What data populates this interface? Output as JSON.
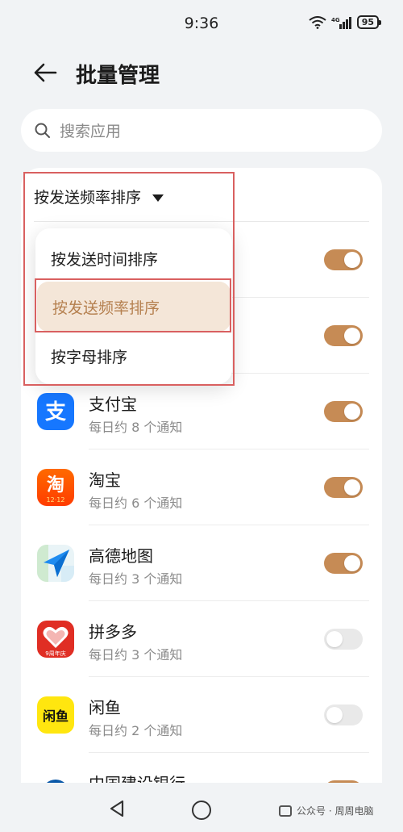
{
  "status_bar": {
    "time": "9:36",
    "network": "4G",
    "battery": "95"
  },
  "header": {
    "title": "批量管理"
  },
  "search": {
    "placeholder": "搜索应用"
  },
  "sort": {
    "current_label": "按发送频率排序",
    "options": [
      {
        "label": "按发送时间排序",
        "selected": false
      },
      {
        "label": "按发送频率排序",
        "selected": true
      },
      {
        "label": "按字母排序",
        "selected": false
      }
    ]
  },
  "apps": [
    {
      "name": "",
      "subtitle": "",
      "enabled": true
    },
    {
      "name": "",
      "subtitle": "",
      "enabled": true
    },
    {
      "name": "支付宝",
      "subtitle": "每日约 8 个通知",
      "enabled": true,
      "icon": "alipay-icon"
    },
    {
      "name": "淘宝",
      "subtitle": "每日约 6 个通知",
      "enabled": true,
      "icon": "taobao-icon"
    },
    {
      "name": "高德地图",
      "subtitle": "每日约 3 个通知",
      "enabled": true,
      "icon": "amap-icon"
    },
    {
      "name": "拼多多",
      "subtitle": "每日约 3 个通知",
      "enabled": false,
      "icon": "pinduoduo-icon"
    },
    {
      "name": "闲鱼",
      "subtitle": "每日约 2 个通知",
      "enabled": false,
      "icon": "xianyu-icon"
    },
    {
      "name": "中国建设银行",
      "subtitle": "",
      "enabled": true,
      "icon": "ccb-icon"
    }
  ],
  "icon_text": {
    "alipay": "支",
    "taobao": "淘",
    "taobao_badge": "12·12",
    "pinduoduo_badge": "9周年庆",
    "xianyu": "闲鱼"
  },
  "watermark": {
    "text": "公众号 · 周周电脑"
  },
  "colors": {
    "accent": "#c68b55",
    "selected_bg": "#f4e6d8",
    "selected_text": "#b5804f",
    "annotation": "#d96060"
  }
}
